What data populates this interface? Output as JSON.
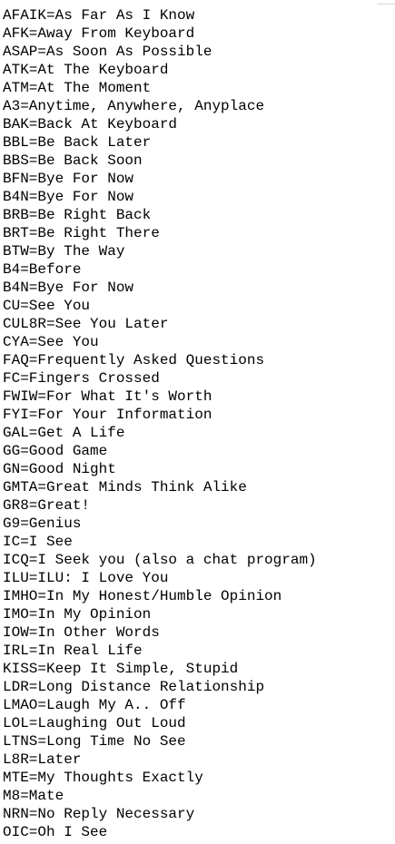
{
  "document": {
    "lines": [
      "AFAIK=As Far As I Know",
      "AFK=Away From Keyboard",
      "ASAP=As Soon As Possible",
      "ATK=At The Keyboard",
      "ATM=At The Moment",
      "A3=Anytime, Anywhere, Anyplace",
      "BAK=Back At Keyboard",
      "BBL=Be Back Later",
      "BBS=Be Back Soon",
      "BFN=Bye For Now",
      "B4N=Bye For Now",
      "BRB=Be Right Back",
      "BRT=Be Right There",
      "BTW=By The Way",
      "B4=Before",
      "B4N=Bye For Now",
      "CU=See You",
      "CUL8R=See You Later",
      "CYA=See You",
      "FAQ=Frequently Asked Questions",
      "FC=Fingers Crossed",
      "FWIW=For What It's Worth",
      "FYI=For Your Information",
      "GAL=Get A Life",
      "GG=Good Game",
      "GN=Good Night",
      "GMTA=Great Minds Think Alike",
      "GR8=Great!",
      "G9=Genius",
      "IC=I See",
      "ICQ=I Seek you (also a chat program)",
      "ILU=ILU: I Love You",
      "IMHO=In My Honest/Humble Opinion",
      "IMO=In My Opinion",
      "IOW=In Other Words",
      "IRL=In Real Life",
      "KISS=Keep It Simple, Stupid",
      "LDR=Long Distance Relationship",
      "LMAO=Laugh My A.. Off",
      "LOL=Laughing Out Loud",
      "LTNS=Long Time No See",
      "L8R=Later",
      "MTE=My Thoughts Exactly",
      "M8=Mate",
      "NRN=No Reply Necessary",
      "OIC=Oh I See"
    ]
  }
}
